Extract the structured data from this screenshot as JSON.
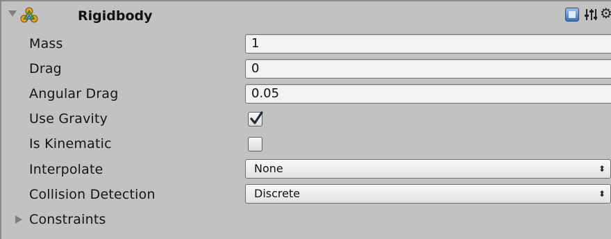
{
  "component": {
    "title": "Rigidbody",
    "enabled": true,
    "icons": {
      "component": "rigidbody-icon",
      "help": "help-book-icon",
      "preset": "preset-sliders-icon",
      "settings": "gear-icon",
      "foldout": "triangle-down-icon"
    }
  },
  "fields": {
    "mass": {
      "label": "Mass",
      "value": "1"
    },
    "drag": {
      "label": "Drag",
      "value": "0"
    },
    "angular_drag": {
      "label": "Angular Drag",
      "value": "0.05"
    },
    "use_gravity": {
      "label": "Use Gravity",
      "checked": true
    },
    "is_kinematic": {
      "label": "Is Kinematic",
      "checked": false
    },
    "interpolate": {
      "label": "Interpolate",
      "value": "None"
    },
    "collision_detection": {
      "label": "Collision Detection",
      "value": "Discrete"
    }
  },
  "constraints": {
    "label": "Constraints",
    "expanded": false
  },
  "colors": {
    "panel_background": "#c2c2c2",
    "field_background": "#f3f3f3",
    "check_mark": "#1e2a3c",
    "help_icon": "#3b6fb6"
  }
}
